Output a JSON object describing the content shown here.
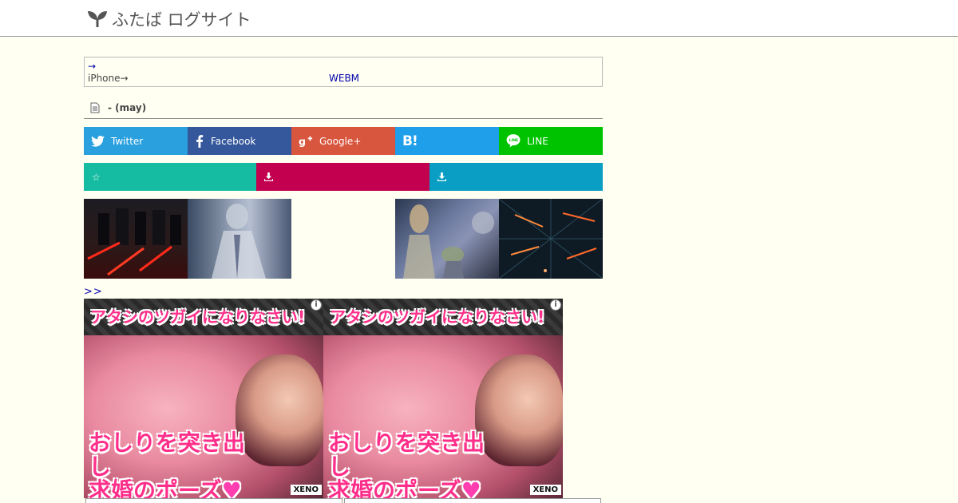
{
  "header": {
    "site_name": "ふたば ログサイト",
    "logo_icon": "sprout-icon"
  },
  "notice": {
    "arrow_link": "→",
    "device_text": "iPhone→",
    "webm_link": "WEBM"
  },
  "post": {
    "title": "- (may)",
    "doc_icon": "document-icon"
  },
  "share": {
    "twitter": "Twitter",
    "facebook": "Facebook",
    "googleplus": "Google+",
    "hatena": "B!",
    "line": "LINE",
    "colors": {
      "twitter": "#2aa0de",
      "facebook": "#35589c",
      "googleplus": "#d8553e",
      "hatena": "#1f9fea",
      "line": "#00c300"
    }
  },
  "actions": {
    "favorite_glyph": "☆",
    "download_icon": "download-icon",
    "colors": {
      "favorite": "#16bca1",
      "download1": "#c2004f",
      "download2": "#0b9ec4"
    }
  },
  "thumbnails": {
    "count": 4
  },
  "more_link": ">>",
  "ads": [
    {
      "headline": "アタシのツガイになりなさい!",
      "line1": "おしりを突き出し",
      "line2": "求婚のポーズ",
      "heart": "♥",
      "brand": "XENO"
    },
    {
      "headline": "アタシのツガイになりなさい!",
      "line1": "おしりを突き出し",
      "line2": "求婚のポーズ",
      "heart": "♥",
      "brand": "XENO"
    }
  ]
}
